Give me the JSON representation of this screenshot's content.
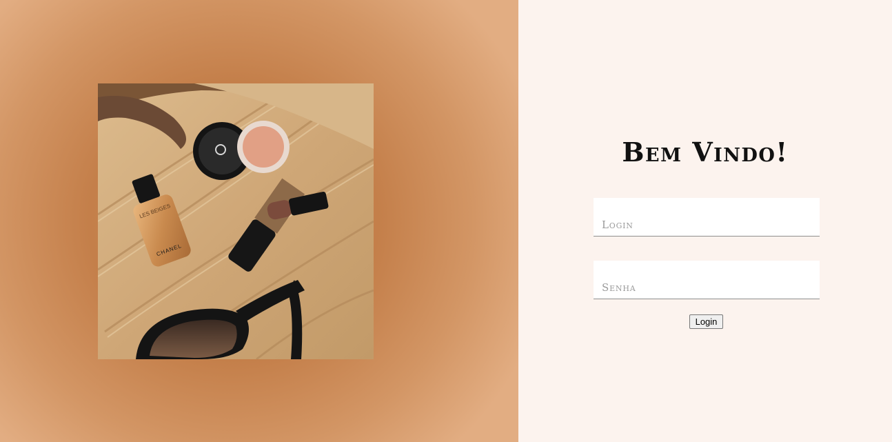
{
  "hero": {
    "image_alt": "Chanel makeup products",
    "brand_text": "CHANEL",
    "bottle_text": "LES BEIGES"
  },
  "form": {
    "title": "Bem Vindo!",
    "login_placeholder": "Login",
    "senha_placeholder": "Senha",
    "submit_label": "Login"
  }
}
